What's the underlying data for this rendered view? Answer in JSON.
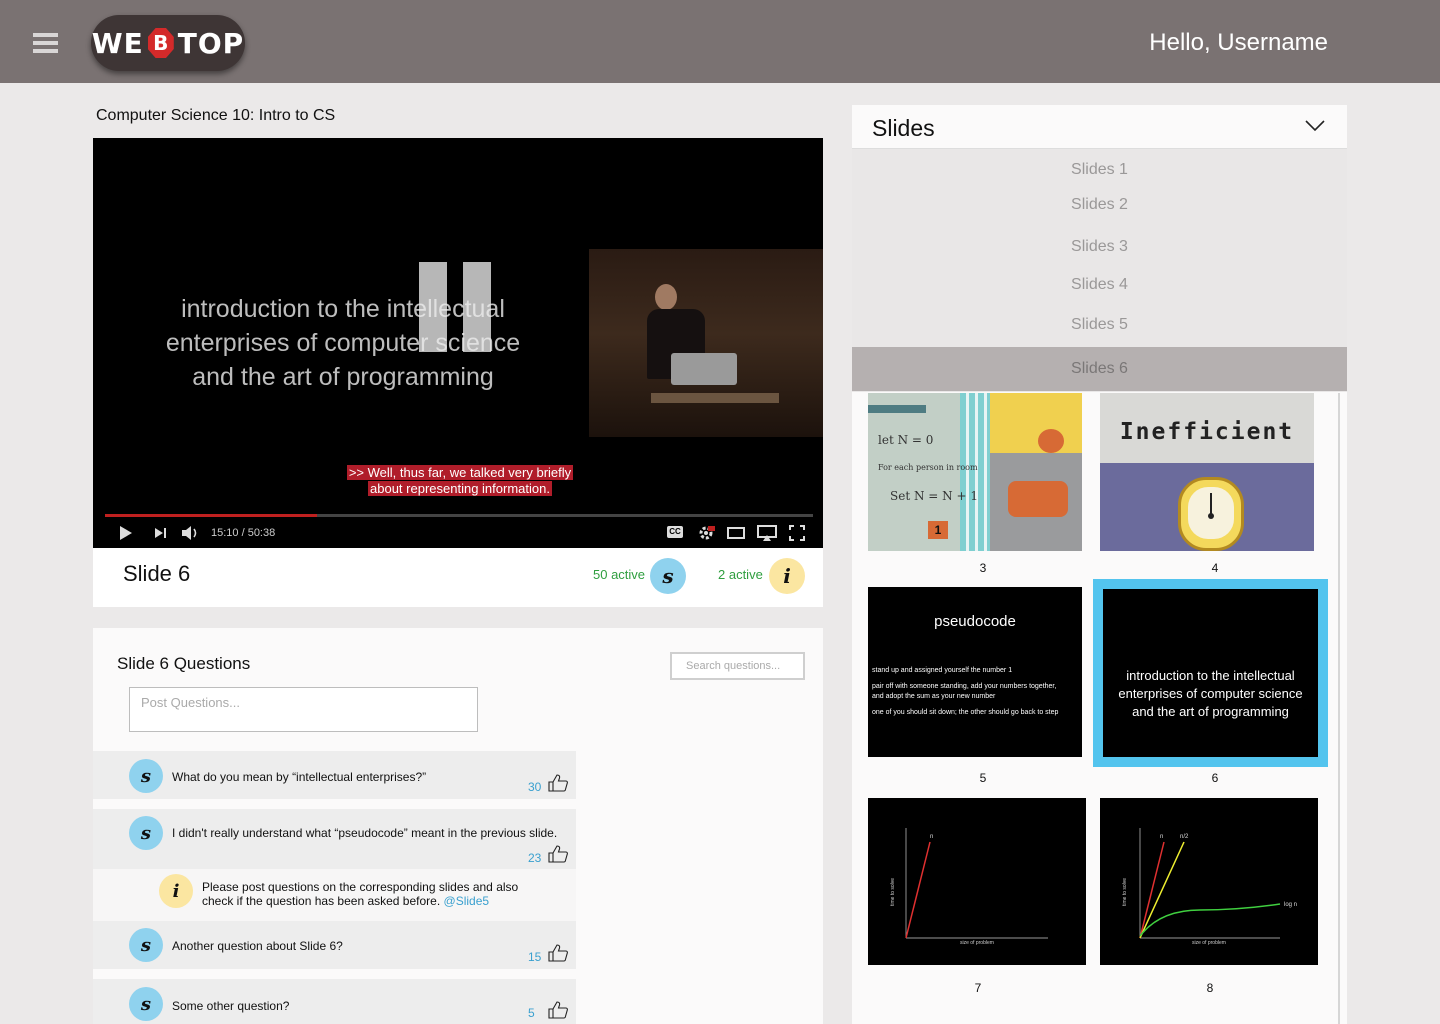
{
  "header": {
    "logo_part1": "WE",
    "logo_mark": "B",
    "logo_part2": "TOP",
    "greeting": "Hello, Username",
    "menu_icon": "hamburger-menu-icon"
  },
  "course": {
    "title": "Computer Science 10: Intro to CS"
  },
  "video": {
    "slide_text_line1": "introduction to the intellectual",
    "slide_text_line2": "enterprises of computer science",
    "slide_text_line3": "and the art of programming",
    "caption_line1": ">> Well, thus far, we talked very briefly",
    "caption_line2": "about representing information.",
    "time": "15:10 / 50:38",
    "progress": 0.3,
    "cc_label": "CC",
    "icons": [
      "play-icon",
      "next-icon",
      "volume-icon",
      "captions-icon",
      "settings-icon",
      "theater-mode-icon",
      "airplay-icon",
      "fullscreen-icon"
    ]
  },
  "slide_bar": {
    "name": "Slide 6",
    "students_active": "50 active",
    "student_badge": "s",
    "instructors_active": "2 active",
    "instructor_badge": "i"
  },
  "questions": {
    "title": "Slide 6 Questions",
    "search_placeholder": "Search questions...",
    "post_placeholder": "Post Questions...",
    "items": [
      {
        "badge": "s",
        "text": "What do you mean by “intellectual enterprises?”",
        "votes": "30"
      },
      {
        "badge": "s",
        "text": "I didn't really understand what “pseudocode” meant in the previous slide.",
        "votes": "23"
      },
      {
        "badge": "i",
        "text1": "Please post questions on the corresponding slides and also",
        "text2": "check if the question has been asked before.",
        "link": "@Slide5"
      },
      {
        "badge": "s",
        "text": "Another question about Slide 6?",
        "votes": "15"
      },
      {
        "badge": "s",
        "text": "Some other question?",
        "votes": "5"
      }
    ]
  },
  "slides_panel": {
    "title": "Slides",
    "options": [
      "Slides 1",
      "Slides 2",
      "Slides 3",
      "Slides 4",
      "Slides 5",
      "Slides 6"
    ],
    "selected": "Slides 6",
    "thumbnails": [
      {
        "number": "3",
        "lines": [
          "let N = 0",
          "For each person in room",
          "Set N = N + 1"
        ],
        "tag": "1"
      },
      {
        "number": "4",
        "title": "Inefficient"
      },
      {
        "number": "5",
        "title": "pseudocode",
        "lines": [
          "stand up and assigned yourself the number 1",
          "pair off with someone standing, add your numbers together,",
          "and adopt the sum as your new number",
          "one of you should sit down; the other should go back to step"
        ]
      },
      {
        "number": "6",
        "lines": [
          "introduction to the intellectual",
          "enterprises of computer science",
          "and the art of programming"
        ],
        "selected": true
      },
      {
        "number": "7",
        "labels": [
          "n",
          "size of problem",
          "time to solve"
        ]
      },
      {
        "number": "8",
        "labels": [
          "n",
          "n/2",
          "log n",
          "size of problem",
          "time to solve"
        ]
      }
    ]
  },
  "colors": {
    "header": "#7a7272",
    "student_badge": "#8fd2ee",
    "instructor_badge": "#fbe6a1",
    "active_text": "#2f9e3f",
    "link": "#3aa0cf",
    "selected_slide_border": "#53c4ee",
    "caption_bg": "#b01d2a"
  }
}
